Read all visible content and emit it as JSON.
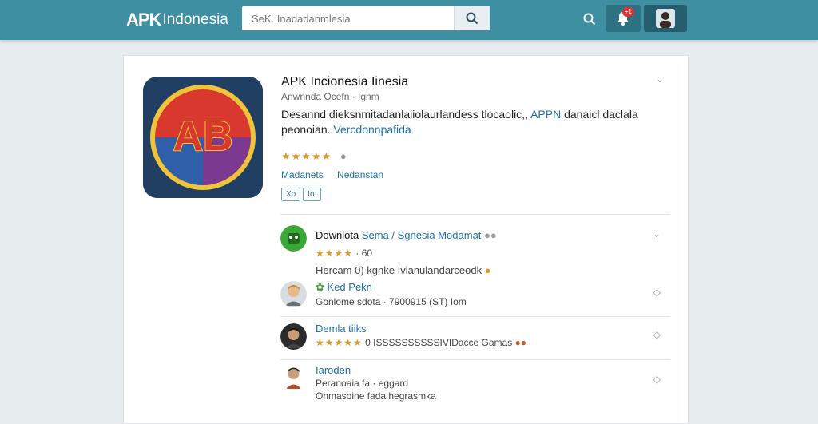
{
  "header": {
    "logo_a": "APK",
    "logo_text": "Indonesia",
    "search_placeholder": "SeK. Inadadanmlesia",
    "notification_count": "+1"
  },
  "app": {
    "title": "APK Incionesia Iinesia",
    "meta": "Anwnnda Ocefn  ·  Ignm",
    "desc_plain": "Desannd dieksnmitadanlaiiolaurlandess tlocaolic,,",
    "desc_link": "APPN",
    "desc_plain2": "danaicl daclala",
    "desc_line2_plain": "peonoian.",
    "desc_line2_link": "Vercdonnpafida",
    "stars": "★★★★★",
    "links": [
      "Madanets",
      "Nedanstan"
    ],
    "tags": [
      "Xo",
      "Io:"
    ]
  },
  "reviews": [
    {
      "name": "Downlota",
      "name_sub": "Sema / Sgnesia  Modamat",
      "stars": "★★★★",
      "extra": "·  60",
      "text": "Hercam 0) kgnke Ivlanulandarceodk"
    },
    {
      "name": "Ked Pekn",
      "line": "Gonlome sdota  ·  7900915 (ST) Iom"
    },
    {
      "name": "Demla tiiks",
      "stars": "★★★★★",
      "line": "0  ISSSSSSSSSSIVIDacce  Gamas"
    },
    {
      "name": "Iaroden",
      "line1": "Peranoaia  fa  ·  eggard",
      "line2": "Onmasoine fada hegrasmka"
    }
  ],
  "colors": {
    "header": "#3f8fa3",
    "link": "#1f6fa8",
    "star": "#e09a2a"
  }
}
